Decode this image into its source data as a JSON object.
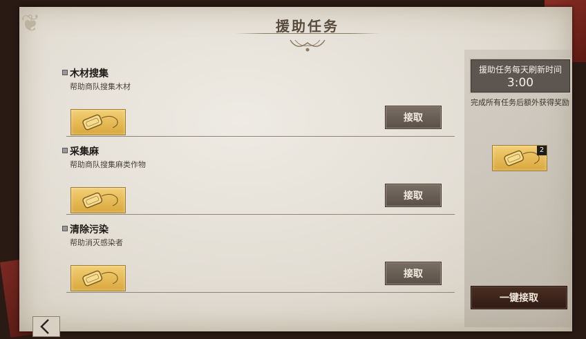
{
  "header": {
    "title": "援助任务"
  },
  "tasks": [
    {
      "name": "木材搜集",
      "description": "帮助商队搜集木材",
      "accept_label": "接取",
      "reward_icon": "dog-tag-icon"
    },
    {
      "name": "采集麻",
      "description": "帮助商队搜集麻类作物",
      "accept_label": "接取",
      "reward_icon": "dog-tag-icon"
    },
    {
      "name": "清除污染",
      "description": "帮助消灭感染者",
      "accept_label": "接取",
      "reward_icon": "dog-tag-icon"
    }
  ],
  "sidebar": {
    "refresh_label": "援助任务每天刷新时间",
    "refresh_time": "3:00",
    "bonus_text": "完成所有任务后额外获得奖励",
    "bonus_reward_count": "2",
    "accept_all_label": "一键接取"
  },
  "nav": {
    "back_icon": "chevron-left-icon"
  },
  "colors": {
    "paper": "#e2ddd3",
    "accept_button": "#6a5f56",
    "accept_all_button": "#3a241c",
    "reward_gold": "#e8bb55"
  }
}
